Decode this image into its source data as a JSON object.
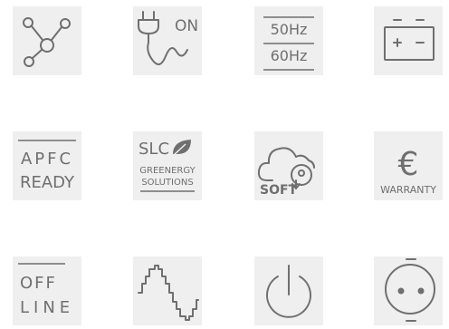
{
  "tiles": [
    {
      "id": "network",
      "icon": "network-nodes-icon"
    },
    {
      "id": "plug-on",
      "icon": "power-plug-on-icon",
      "text": "ON"
    },
    {
      "id": "frequency",
      "icon": "frequency-icon",
      "line1": "50Hz",
      "line2": "60Hz"
    },
    {
      "id": "battery",
      "icon": "battery-icon",
      "plus": "+",
      "minus": "-"
    },
    {
      "id": "apfc",
      "icon": "apfc-ready-icon",
      "line1": "APFC",
      "line2": "READY"
    },
    {
      "id": "slc",
      "icon": "slc-greenergy-icon",
      "line1": "SLC",
      "line2": "GREENERGY",
      "line3": "SOLUTIONS"
    },
    {
      "id": "soft",
      "icon": "cloud-download-soft-icon",
      "text": "SOFT"
    },
    {
      "id": "warranty",
      "icon": "euro-warranty-icon",
      "symbol": "€",
      "text": "WARRANTY"
    },
    {
      "id": "offline",
      "icon": "offline-icon",
      "line1": "OFF",
      "line2": "LINE"
    },
    {
      "id": "sine",
      "icon": "stepped-sine-wave-icon"
    },
    {
      "id": "power",
      "icon": "power-button-icon"
    },
    {
      "id": "socket",
      "icon": "power-socket-icon"
    }
  ]
}
